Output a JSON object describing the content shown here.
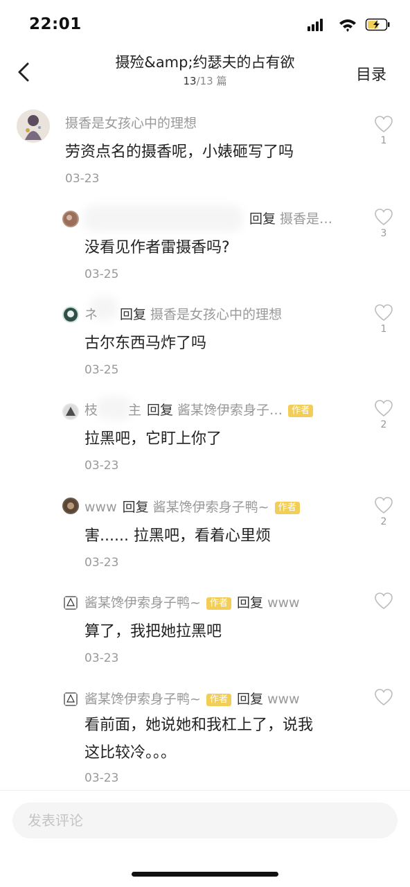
{
  "status_bar": {
    "time": "22:01"
  },
  "nav": {
    "title": "摄殓&amp;约瑟夫的占有欲",
    "page_current": "13",
    "page_total_text": "/13 篇",
    "toc_label": "目录"
  },
  "reply_word": "回复",
  "author_badge": "作者",
  "comments": [
    {
      "user": "摄香是女孩心中的理想",
      "text": "劳资点名的摄香呢，小婊砸写了吗",
      "date": "03-23",
      "likes": "1"
    },
    {
      "user": "",
      "reply_to": "摄香是…",
      "text": "没看见作者雷摄香吗?",
      "date": "03-25",
      "likes": "3"
    },
    {
      "user": "ネ",
      "reply_to": "摄香是女孩心中的理想",
      "text": "古尔东西马炸了吗",
      "date": "03-25",
      "likes": "1"
    },
    {
      "user": "枝",
      "user_tail": "主",
      "reply_to": "酱某馋伊索身子…",
      "text": "拉黑吧，它盯上你了",
      "date": "03-23",
      "likes": "2"
    },
    {
      "user": "www",
      "reply_to": "酱某馋伊索身子鸭~",
      "text": "害...... 拉黑吧，看着心里烦",
      "date": "03-23",
      "likes": "2"
    },
    {
      "user": "酱某馋伊索身子鸭~",
      "reply_to": "www",
      "text": "算了，我把她拉黑吧",
      "date": "03-23",
      "likes": ""
    },
    {
      "user": "酱某馋伊索身子鸭~",
      "reply_to": "www",
      "text_line1": "看前面，她说她和我杠上了，说我",
      "text_line2": "这比较冷。。。",
      "date": "03-23",
      "likes": ""
    }
  ],
  "input": {
    "placeholder": "发表评论"
  },
  "colors": {
    "badge": "#f2ce59",
    "muted_text": "#999999",
    "main_text": "#222222"
  }
}
